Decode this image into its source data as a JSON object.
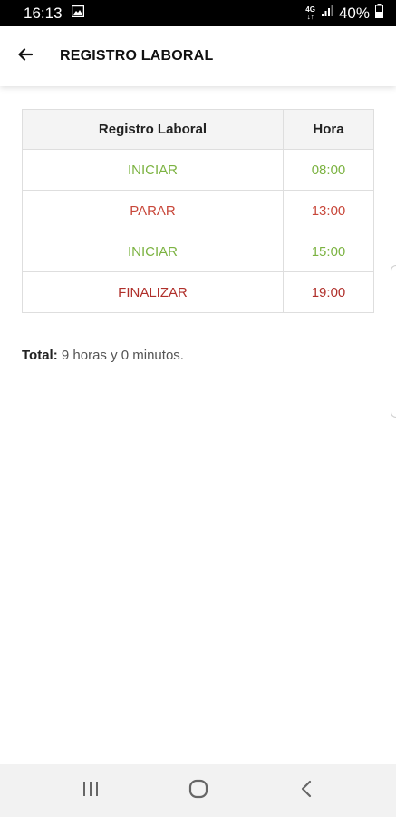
{
  "status_bar": {
    "time": "16:13",
    "network_top": "4G",
    "network_bottom": "↓↑",
    "battery": "40%"
  },
  "header": {
    "title": "REGISTRO LABORAL",
    "back_icon": "arrow-left-icon"
  },
  "table": {
    "headers": [
      "Registro Laboral",
      "Hora"
    ],
    "rows": [
      {
        "action": "INICIAR",
        "time": "08:00",
        "color": "#7cb342"
      },
      {
        "action": "PARAR",
        "time": "13:00",
        "color": "#c8473a"
      },
      {
        "action": "INICIAR",
        "time": "15:00",
        "color": "#7cb342"
      },
      {
        "action": "FINALIZAR",
        "time": "19:00",
        "color": "#b0302b"
      }
    ]
  },
  "total": {
    "label": "Total:",
    "value": " 9 horas y 0 minutos."
  },
  "nav_bar": {
    "recents_icon": "recents-icon",
    "home_icon": "home-icon",
    "back_icon": "back-chevron-icon"
  }
}
